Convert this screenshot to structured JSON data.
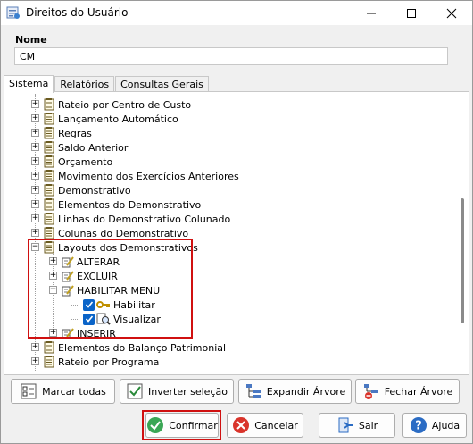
{
  "window": {
    "title": "Direitos do Usuário"
  },
  "nome": {
    "label": "Nome",
    "value": "CM"
  },
  "tabs": [
    {
      "label": "Sistema",
      "active": true
    },
    {
      "label": "Relatórios",
      "active": false
    },
    {
      "label": "Consultas Gerais",
      "active": false
    }
  ],
  "tree": {
    "items": [
      {
        "label": "Rateio por Centro de Custo"
      },
      {
        "label": "Lançamento Automático"
      },
      {
        "label": "Regras"
      },
      {
        "label": "Saldo Anterior"
      },
      {
        "label": "Orçamento"
      },
      {
        "label": "Movimento dos Exercícios Anteriores"
      },
      {
        "label": "Demonstrativo"
      },
      {
        "label": "Elementos do Demonstrativo"
      },
      {
        "label": "Linhas do Demonstrativo Colunado"
      },
      {
        "label": "Colunas do Demonstrativo"
      },
      {
        "label": "Layouts dos Demonstrativos"
      },
      {
        "label": "ALTERAR"
      },
      {
        "label": "EXCLUIR"
      },
      {
        "label": "HABILITAR MENU"
      },
      {
        "label": "Habilitar",
        "checked": true
      },
      {
        "label": "Visualizar",
        "checked": true
      },
      {
        "label": "INSERIR"
      },
      {
        "label": "Elementos do Balanço Patrimonial"
      },
      {
        "label": "Rateio por Programa"
      }
    ]
  },
  "tree_buttons": {
    "mark_all": "Marcar todas",
    "invert": "Inverter seleção",
    "expand": "Expandir Árvore",
    "collapse": "Fechar Árvore"
  },
  "footer_buttons": {
    "confirm": "Confirmar",
    "cancel": "Cancelar",
    "exit": "Sair",
    "help": "Ajuda"
  },
  "colors": {
    "highlight": "#d01010",
    "confirm_icon": "#3aa655",
    "cancel_icon": "#d9342b",
    "help_icon": "#2b6cc4"
  }
}
